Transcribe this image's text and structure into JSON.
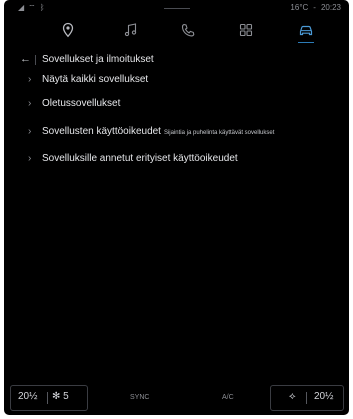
{
  "status_bar": {
    "left_icons": [
      "signal-icon",
      "wifi-icon",
      "bluetooth-icon"
    ],
    "temperature": "16°C",
    "separator": "-",
    "time": "20:23"
  },
  "nav": {
    "items": [
      {
        "name": "navigation",
        "icon": "location-pin-icon"
      },
      {
        "name": "music",
        "icon": "music-note-icon"
      },
      {
        "name": "phone",
        "icon": "phone-icon"
      },
      {
        "name": "apps",
        "icon": "apps-grid-icon"
      },
      {
        "name": "vehicle",
        "icon": "car-icon",
        "active": true
      }
    ],
    "active_color": "#2c7bb6"
  },
  "header": {
    "back_icon": "back-arrow-icon",
    "title": "Sovellukset ja ilmoitukset"
  },
  "list": {
    "items": [
      {
        "label": "Näytä kaikki sovellukset",
        "sublabel": ""
      },
      {
        "label": "Oletussovellukset",
        "sublabel": ""
      },
      {
        "label": "Sovellusten käyttöoikeudet",
        "sublabel": "Sijaintia ja puhelinta käyttävät sovellukset"
      },
      {
        "label": "Sovelluksille annetut erityiset käyttöoikeudet",
        "sublabel": ""
      }
    ]
  },
  "climate": {
    "left_temp": "20",
    "left_temp_suffix": "½",
    "fan_speed": "5",
    "sync_label": "SYNC",
    "ac_label": "A/C",
    "right_temp": "20",
    "right_temp_suffix": "½"
  }
}
